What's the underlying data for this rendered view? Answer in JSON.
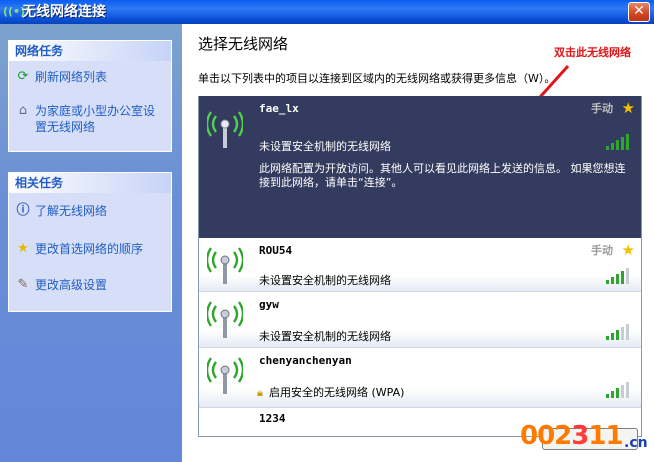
{
  "window": {
    "title": "无线网络连接",
    "close_glyph": "✕"
  },
  "network_tasks": {
    "header": "网络任务",
    "items": [
      {
        "label": "刷新网络列表",
        "icon": "refresh-icon"
      },
      {
        "label": "为家庭或小型办公室设置无线网络",
        "icon": "wireless-setup-icon"
      }
    ]
  },
  "related_tasks": {
    "header": "相关任务",
    "items": [
      {
        "label": "了解无线网络",
        "icon": "info-icon"
      },
      {
        "label": "更改首选网络的顺序",
        "icon": "star-icon"
      },
      {
        "label": "更改高级设置",
        "icon": "tools-icon"
      }
    ]
  },
  "main": {
    "title": "选择无线网络",
    "description": "单击以下列表中的项目以连接到区域内的无线网络或获得更多信息（W）。",
    "annotation": "双击此无线网络"
  },
  "networks": [
    {
      "name": "fae_lx",
      "mode": "手动",
      "security": "未设置安全机制的无线网络",
      "info": "此网络配置为开放访问。其他人可以看见此网络上发送的信息。 如果您想连接到此网络，请单击“连接”。",
      "signal_bars": 5,
      "selected": true,
      "preferred": true
    },
    {
      "name": "ROU54",
      "mode": "手动",
      "security": "未设置安全机制的无线网络",
      "signal_bars": 4,
      "selected": false,
      "preferred": true
    },
    {
      "name": "gyw",
      "mode": "",
      "security": "未设置安全机制的无线网络",
      "signal_bars": 3,
      "selected": false,
      "preferred": false
    },
    {
      "name": "chenyanchenyan",
      "mode": "",
      "security": "启用安全的无线网络  (WPA)",
      "signal_bars": 3,
      "selected": false,
      "preferred": false
    },
    {
      "name": "1234",
      "mode": "",
      "security": "",
      "signal_bars": 0,
      "selected": false,
      "preferred": false
    }
  ],
  "watermark": {
    "digits": "002",
    "ball": "3",
    "digits_tail": "11",
    "suffix": ".cn"
  },
  "colors": {
    "selected_bg": "#333B5E",
    "signal_green": "#2EA62E",
    "task_link": "#215DC6",
    "annotation_red": "#E0151A"
  }
}
